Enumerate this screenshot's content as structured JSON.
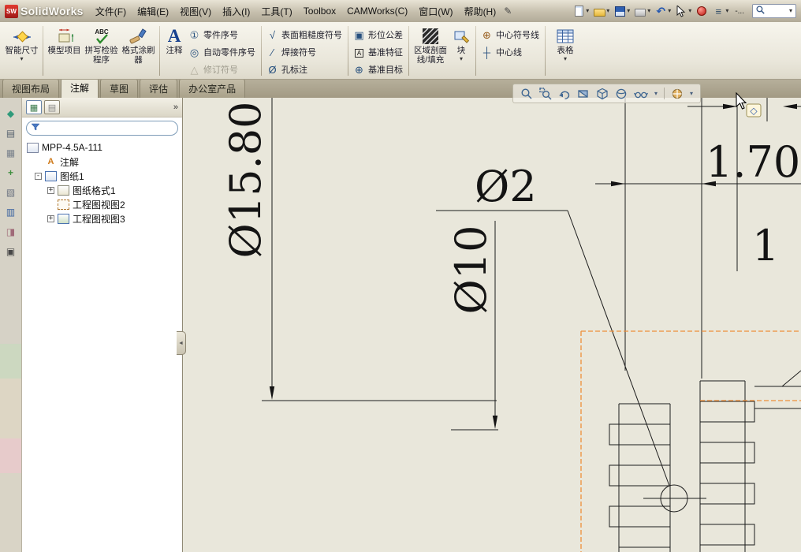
{
  "titlebar": {
    "logo_badge": "SW",
    "logo_text": "SolidWorks",
    "menus": [
      "文件(F)",
      "编辑(E)",
      "视图(V)",
      "插入(I)",
      "工具(T)",
      "Toolbox",
      "CAMWorks(C)",
      "窗口(W)",
      "帮助(H)"
    ],
    "overflow_label": "-..."
  },
  "icons": {
    "dropdown": "▾",
    "collapse": "-",
    "expand": "+",
    "panel_more": "»",
    "splitter": "◄"
  },
  "ribbon": {
    "big_buttons": [
      {
        "label": "智能尺寸"
      },
      {
        "label": "模型项目"
      },
      {
        "label": "拼写检验程序"
      },
      {
        "label": "格式涂刷器"
      },
      {
        "label": "注释"
      }
    ],
    "balloon_group": {
      "items": [
        {
          "label": "零件序号",
          "disabled": false
        },
        {
          "label": "自动零件序号",
          "disabled": false
        },
        {
          "label": "修订符号",
          "disabled": true
        }
      ]
    },
    "symbol_group": {
      "items": [
        {
          "label": "表面粗糙度符号"
        },
        {
          "label": "焊接符号"
        },
        {
          "label": "孔标注"
        }
      ]
    },
    "datum_group": {
      "items": [
        {
          "label": "形位公差"
        },
        {
          "label": "基准特征"
        },
        {
          "label": "基准目标"
        }
      ]
    },
    "hatch_button": {
      "label": "区域剖面线/填充"
    },
    "block_button": {
      "label": "块"
    },
    "center_group": {
      "items": [
        {
          "label": "中心符号线"
        },
        {
          "label": "中心线"
        }
      ]
    },
    "tables_button": {
      "label": "表格"
    }
  },
  "command_tabs": [
    {
      "label": "视图布局",
      "active": false
    },
    {
      "label": "注解",
      "active": true
    },
    {
      "label": "草图",
      "active": false
    },
    {
      "label": "评估",
      "active": false
    },
    {
      "label": "办公室产品",
      "active": false
    }
  ],
  "feature_tree": {
    "root_label": "MPP-4.5A-111",
    "items": [
      {
        "label": "注解"
      },
      {
        "label": "图纸1"
      },
      {
        "label": "图纸格式1"
      },
      {
        "label": "工程图视图2"
      },
      {
        "label": "工程图视图3"
      }
    ]
  },
  "drawing": {
    "dim_diameter_15_80": "Ø15.80",
    "dim_diameter_2": "Ø2",
    "dim_diameter_10": "Ø10",
    "dim_1_70": "1.70",
    "dim_partial_1": "1",
    "line_color": "#1c1c1c",
    "highlight_color": "#ee8f3a",
    "background": "#e9e7db"
  }
}
